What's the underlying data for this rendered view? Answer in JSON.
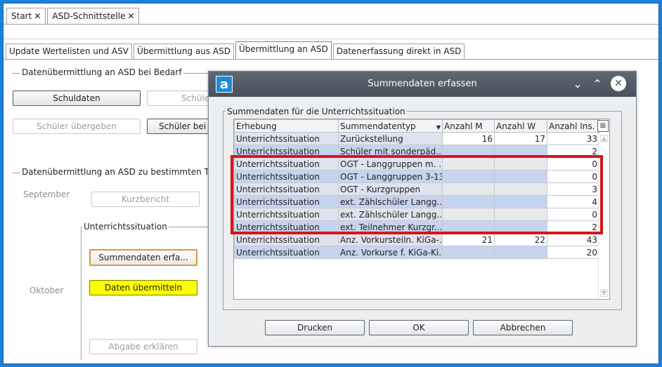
{
  "app_tabs": [
    {
      "label": "Start"
    },
    {
      "label": "ASD-Schnittstelle"
    }
  ],
  "sub_tabs": [
    {
      "label": "Update Wertelisten und ASV"
    },
    {
      "label": "Übermittlung aus ASD"
    },
    {
      "label": "Übermittlung an ASD"
    },
    {
      "label": "Datenerfassung direkt in ASD"
    }
  ],
  "section1": {
    "title": "Datenübermittlung an ASD bei Bedarf",
    "btn_schuldaten": "Schuldaten",
    "btn_schueler_partial": "Schüle",
    "btn_schueler_uebergeben": "Schüler übergeben",
    "btn_schueler_bei": "Schüler bei A"
  },
  "section2": {
    "title": "Datenübermittlung an ASD zu bestimmten Terr",
    "september": "September",
    "btn_kurzbericht": "Kurzbericht",
    "group_title": "Unterrichtssituation",
    "oktober": "Oktober",
    "btn_summendaten": "Summendaten erfa...",
    "btn_daten": "Daten übermitteln",
    "btn_abgabe": "Abgabe erklären"
  },
  "dialog": {
    "title": "Summendaten erfassen",
    "logo": "a",
    "group_title": "Summendaten für die Unterrichtssituation",
    "columns": [
      "Erhebung",
      "Summendatentyp",
      "Anzahl M",
      "Anzahl W",
      "Anzahl Ins."
    ],
    "rows": [
      [
        "Unterrichtssituation",
        "Zurückstellung",
        "16",
        "17",
        "33"
      ],
      [
        "Unterrichtssituation",
        "Schüler mit sonderpäd....",
        "",
        "",
        "2"
      ],
      [
        "Unterrichtssituation",
        "OGT - Langgruppen m. ...",
        "",
        "",
        "0"
      ],
      [
        "Unterrichtssituation",
        "OGT - Langgruppen 3-13",
        "",
        "",
        "0"
      ],
      [
        "Unterrichtssituation",
        "OGT - Kurzgruppen",
        "",
        "",
        "3"
      ],
      [
        "Unterrichtssituation",
        "ext. Zählschüler Langg...",
        "",
        "",
        "4"
      ],
      [
        "Unterrichtssituation",
        "ext. Zählschüler Langg...",
        "",
        "",
        "0"
      ],
      [
        "Unterrichtssituation",
        "ext. Teilnehmer Kurzgr....",
        "",
        "",
        "2"
      ],
      [
        "Unterrichtssituation",
        "Anz. Vorkursteiln. KiGa-...",
        "21",
        "22",
        "43"
      ],
      [
        "Unterrichtssituation",
        "Anz. Vorkurse f. KiGa-Ki...",
        "",
        "",
        "20"
      ]
    ],
    "btn_drucken": "Drucken",
    "btn_ok": "OK",
    "btn_abbrechen": "Abbrechen"
  }
}
